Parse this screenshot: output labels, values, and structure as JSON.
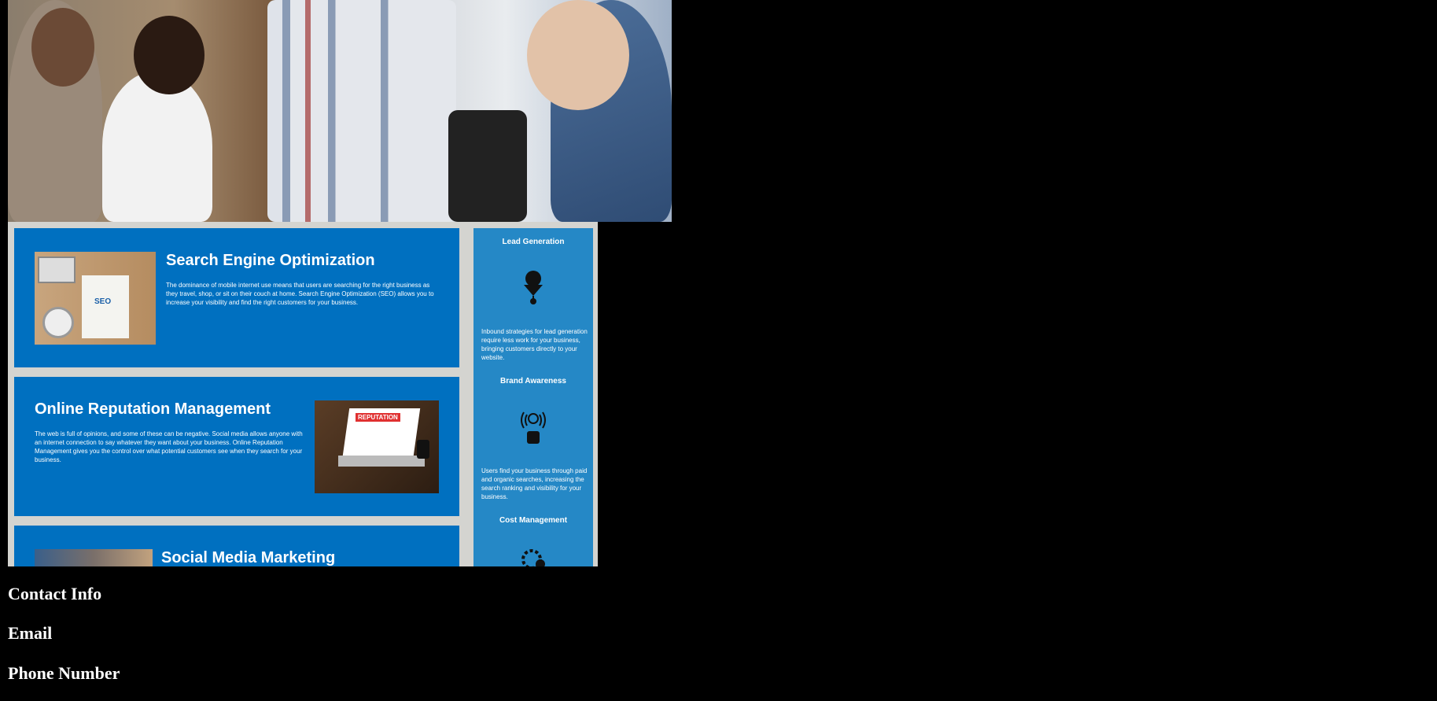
{
  "services": [
    {
      "title": "Search Engine Optimization",
      "description": "The dominance of mobile internet use means that users are searching for the right business as they travel, shop, or sit on their couch at home. Search Engine Optimization (SEO) allows you to increase your visibility and find the right customers for your business."
    },
    {
      "title": "Online Reputation Management",
      "description": "The web is full of opinions, and some of these can be negative. Social media allows anyone with an internet connection to say whatever they want about your business. Online Reputation Management gives you the control over what potential customers see when they search for your business."
    },
    {
      "title": "Social Media Marketing"
    }
  ],
  "benefits": [
    {
      "title": "Lead Generation",
      "icon": "lead-gen-icon",
      "description": "Inbound strategies for lead generation require less work for your business, bringing customers directly to your website."
    },
    {
      "title": "Brand Awareness",
      "icon": "brand-awareness-icon",
      "description": "Users find your business through paid and organic searches, increasing the search ranking and visibility for your business."
    },
    {
      "title": "Cost Management",
      "icon": "cost-management-icon"
    }
  ],
  "thumb_labels": {
    "seo": "SEO",
    "reputation": "REPUTATION"
  },
  "footer": {
    "contact": "Contact Info",
    "email": "Email",
    "phone": "Phone Number"
  },
  "colors": {
    "card_blue": "#0070c0",
    "sidebar_blue": "#2588c6",
    "content_bg": "#d4d4d0"
  }
}
